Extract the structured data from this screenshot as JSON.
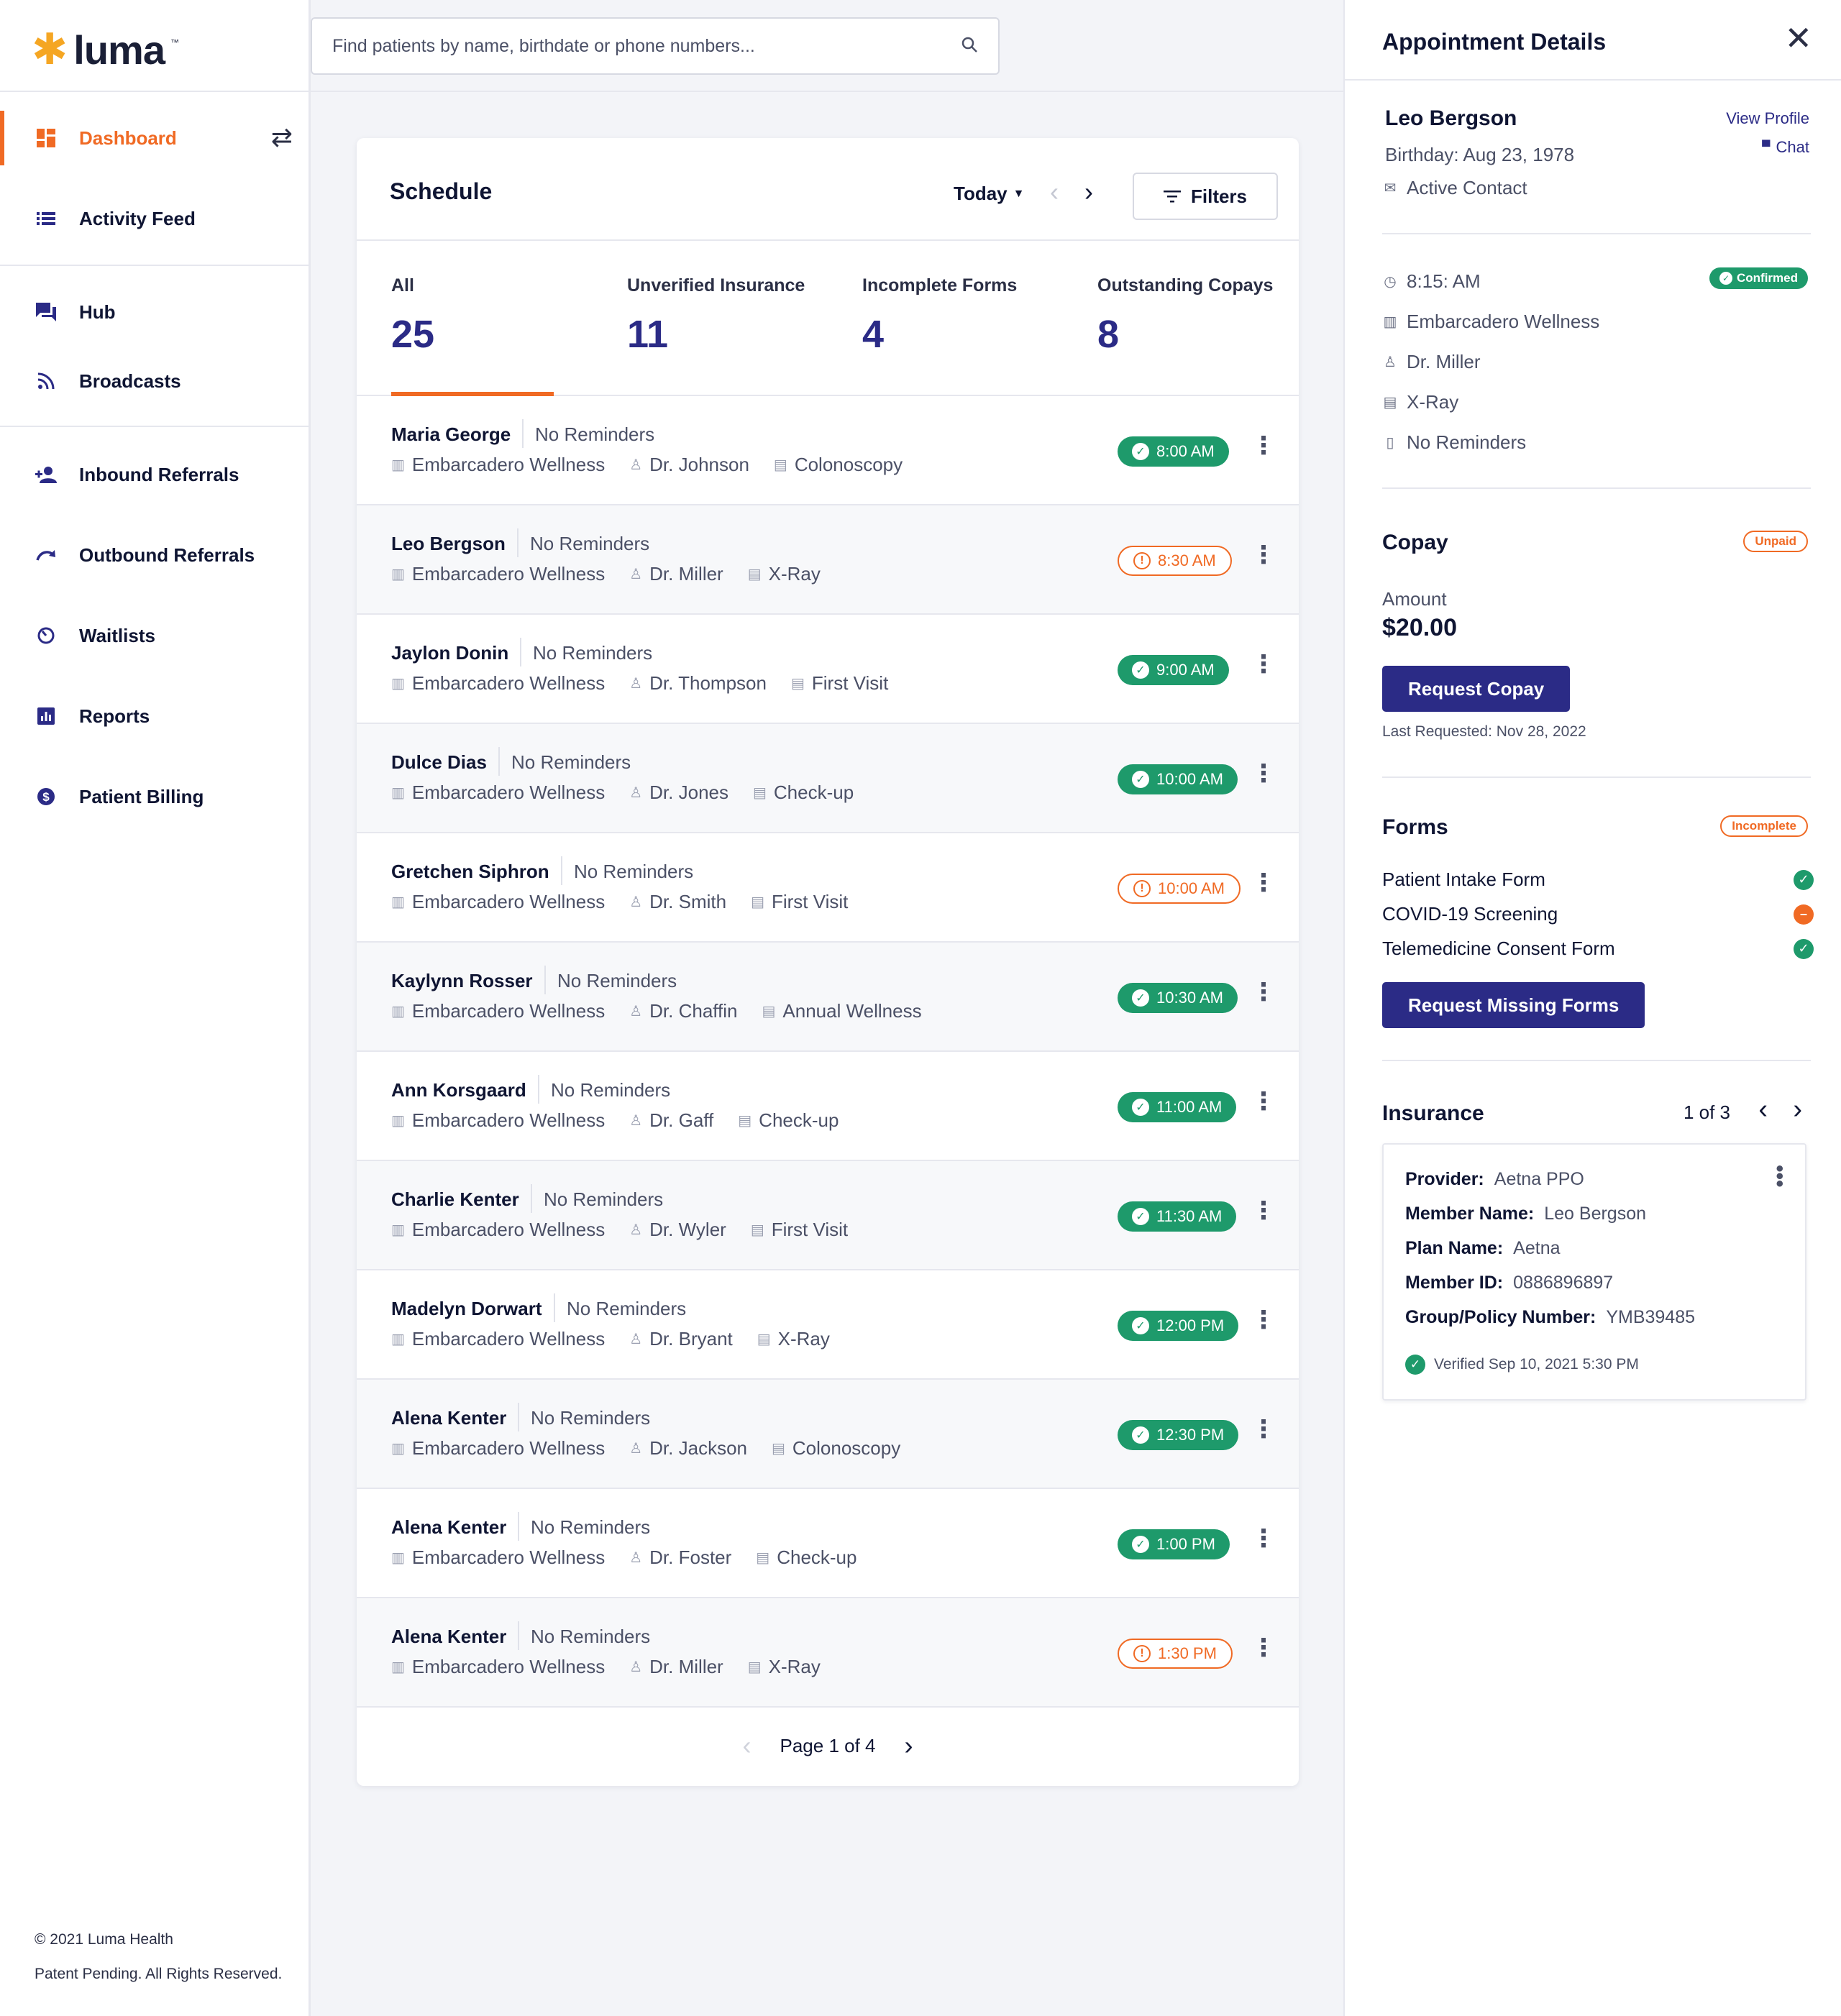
{
  "brand": {
    "name": "luma",
    "tm": "™",
    "accent": "#f06a24",
    "primary": "#2b2b86",
    "success": "#1e9a6b"
  },
  "search": {
    "placeholder": "Find patients by name, birthdate or phone numbers..."
  },
  "nav": {
    "dashboard": "Dashboard",
    "activity_feed": "Activity Feed",
    "hub": "Hub",
    "broadcasts": "Broadcasts",
    "inbound_referrals": "Inbound Referrals",
    "outbound_referrals": "Outbound Referrals",
    "waitlists": "Waitlists",
    "reports": "Reports",
    "patient_billing": "Patient Billing"
  },
  "footer": {
    "copyright": "© 2021 Luma Health",
    "rights": "Patent Pending. All Rights Reserved."
  },
  "schedule": {
    "title": "Schedule",
    "range": "Today",
    "filters_label": "Filters",
    "stats": [
      {
        "label": "All",
        "value": "25"
      },
      {
        "label": "Unverified Insurance",
        "value": "11"
      },
      {
        "label": "Incomplete Forms",
        "value": "4"
      },
      {
        "label": "Outstanding Copays",
        "value": "8"
      }
    ],
    "rows": [
      {
        "name": "Maria George",
        "reminders": "No Reminders",
        "location": "Embarcadero Wellness",
        "doctor": "Dr. Johnson",
        "type": "Colonoscopy",
        "time": "8:00 AM",
        "status": "confirmed"
      },
      {
        "name": "Leo Bergson",
        "reminders": "No Reminders",
        "location": "Embarcadero Wellness",
        "doctor": "Dr. Miller",
        "type": "X-Ray",
        "time": "8:30 AM",
        "status": "warning"
      },
      {
        "name": "Jaylon Donin",
        "reminders": "No Reminders",
        "location": "Embarcadero Wellness",
        "doctor": "Dr. Thompson",
        "type": "First Visit",
        "time": "9:00 AM",
        "status": "confirmed"
      },
      {
        "name": "Dulce Dias",
        "reminders": "No Reminders",
        "location": "Embarcadero Wellness",
        "doctor": "Dr. Jones",
        "type": "Check-up",
        "time": "10:00 AM",
        "status": "confirmed"
      },
      {
        "name": "Gretchen Siphron",
        "reminders": "No Reminders",
        "location": "Embarcadero Wellness",
        "doctor": "Dr. Smith",
        "type": "First Visit",
        "time": "10:00 AM",
        "status": "warning"
      },
      {
        "name": "Kaylynn Rosser",
        "reminders": "No Reminders",
        "location": "Embarcadero Wellness",
        "doctor": "Dr. Chaffin",
        "type": "Annual Wellness",
        "time": "10:30 AM",
        "status": "confirmed"
      },
      {
        "name": "Ann Korsgaard",
        "reminders": "No Reminders",
        "location": "Embarcadero Wellness",
        "doctor": "Dr. Gaff",
        "type": "Check-up",
        "time": "11:00 AM",
        "status": "confirmed"
      },
      {
        "name": "Charlie Kenter",
        "reminders": "No Reminders",
        "location": "Embarcadero Wellness",
        "doctor": "Dr. Wyler",
        "type": "First Visit",
        "time": "11:30 AM",
        "status": "confirmed"
      },
      {
        "name": "Madelyn Dorwart",
        "reminders": "No Reminders",
        "location": "Embarcadero Wellness",
        "doctor": "Dr. Bryant",
        "type": "X-Ray",
        "time": "12:00 PM",
        "status": "confirmed"
      },
      {
        "name": "Alena Kenter",
        "reminders": "No Reminders",
        "location": "Embarcadero Wellness",
        "doctor": "Dr. Jackson",
        "type": "Colonoscopy",
        "time": "12:30 PM",
        "status": "confirmed"
      },
      {
        "name": "Alena Kenter",
        "reminders": "No Reminders",
        "location": "Embarcadero Wellness",
        "doctor": "Dr. Foster",
        "type": "Check-up",
        "time": "1:00 PM",
        "status": "confirmed"
      },
      {
        "name": "Alena Kenter",
        "reminders": "No Reminders",
        "location": "Embarcadero Wellness",
        "doctor": "Dr. Miller",
        "type": "X-Ray",
        "time": "1:30 PM",
        "status": "warning"
      }
    ],
    "pagination": "Page 1 of 4"
  },
  "details": {
    "title": "Appointment Details",
    "patient": {
      "name": "Leo Bergson",
      "birthday": "Birthday: Aug 23, 1978",
      "contact": "Active Contact",
      "view_profile": "View Profile",
      "chat": "Chat"
    },
    "appointment": {
      "time": "8:15: AM",
      "status": "Confirmed",
      "location": "Embarcadero Wellness",
      "doctor": "Dr. Miller",
      "type": "X-Ray",
      "reminders": "No Reminders"
    },
    "copay": {
      "title": "Copay",
      "status": "Unpaid",
      "amount_label": "Amount",
      "amount": "$20.00",
      "button": "Request Copay",
      "last_requested": "Last Requested: Nov 28, 2022"
    },
    "forms": {
      "title": "Forms",
      "status": "Incomplete",
      "items": [
        {
          "label": "Patient Intake Form",
          "state": "complete"
        },
        {
          "label": "COVID-19 Screening",
          "state": "missing"
        },
        {
          "label": "Telemedicine Consent Form",
          "state": "complete"
        }
      ],
      "button": "Request Missing Forms"
    },
    "insurance": {
      "title": "Insurance",
      "pager": "1 of 3",
      "fields": [
        {
          "key": "Provider:",
          "value": "Aetna PPO"
        },
        {
          "key": "Member Name:",
          "value": "Leo Bergson"
        },
        {
          "key": "Plan Name:",
          "value": "Aetna"
        },
        {
          "key": "Member ID:",
          "value": "0886896897"
        },
        {
          "key": "Group/Policy Number:",
          "value": "YMB39485"
        }
      ],
      "verified": "Verified Sep 10, 2021 5:30 PM"
    }
  }
}
